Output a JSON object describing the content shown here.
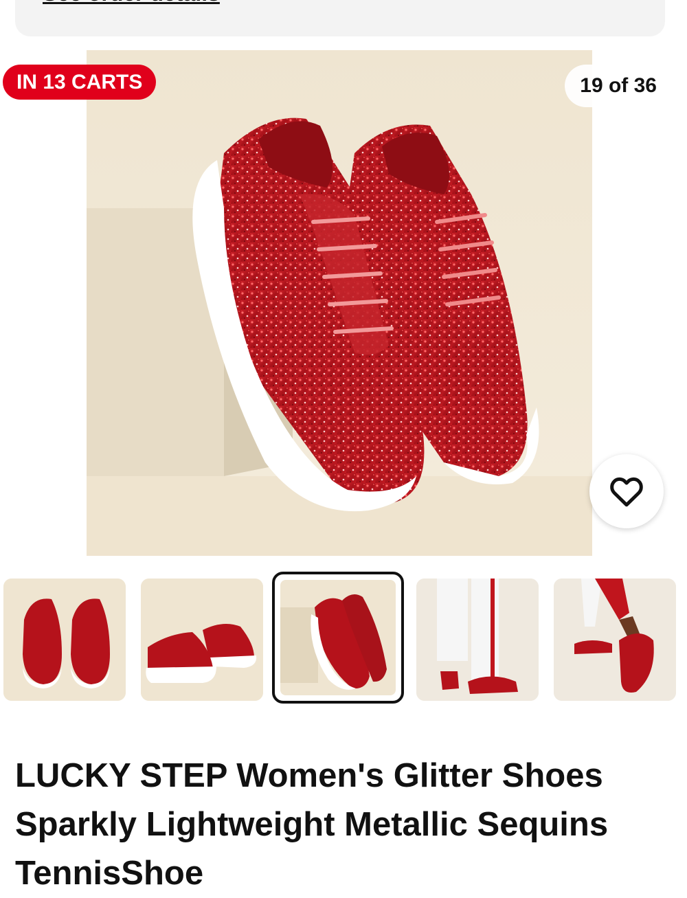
{
  "order": {
    "link_label": "See order details"
  },
  "gallery": {
    "carts_badge": "IN 13 CARTS",
    "counter": "19 of 36",
    "favorite_icon": "heart-outline-icon",
    "thumbnail_count": 5,
    "selected_thumbnail": 3
  },
  "product": {
    "title": "LUCKY STEP Women's Glitter Shoes Sparkly Lightweight Metallic Sequins TennisShoe"
  },
  "colors": {
    "badge_red": "#e0001b",
    "shoe_red": "#b5121b",
    "background_beige": "#efe7d6"
  }
}
